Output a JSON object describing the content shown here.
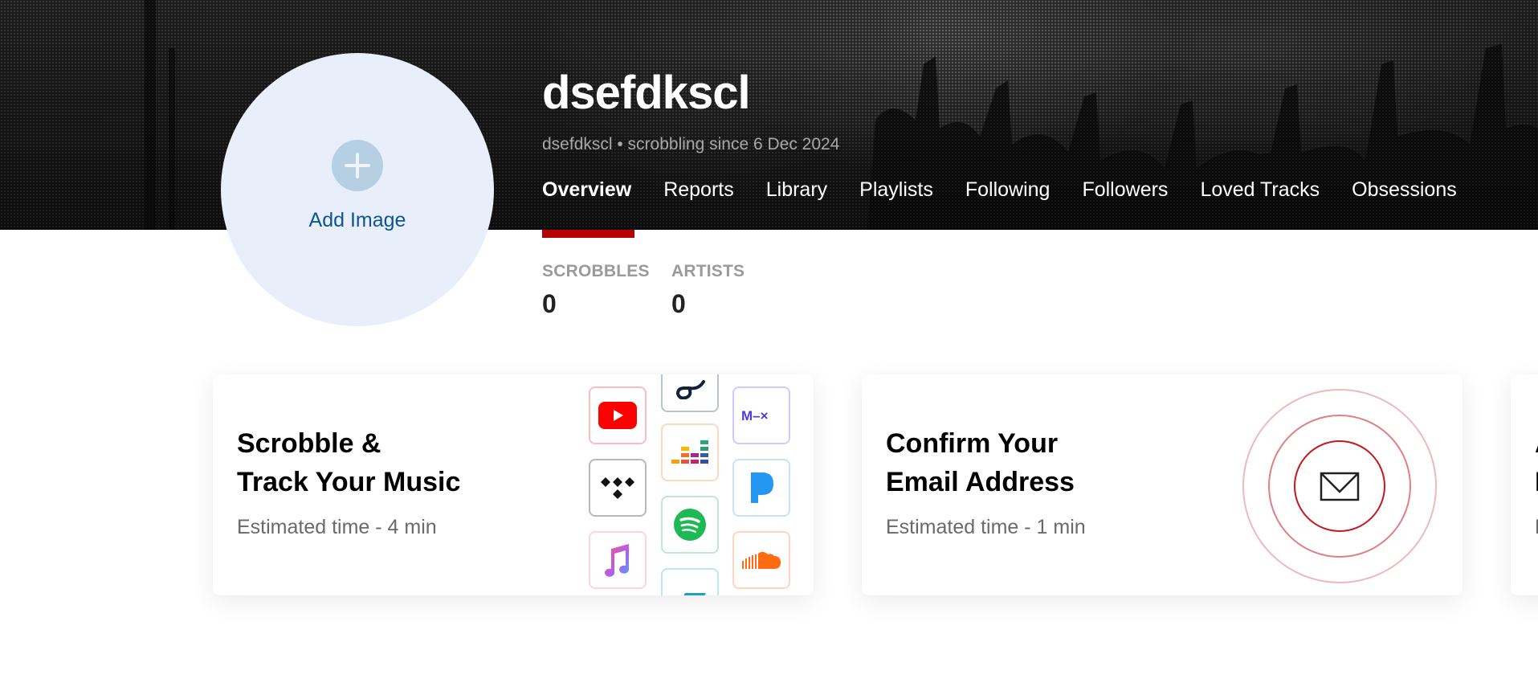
{
  "profile": {
    "username": "dsefdkscl",
    "subline": "dsefdkscl • scrobbling since 6 Dec 2024",
    "avatar": {
      "label": "Add Image",
      "icon": "plus-icon"
    }
  },
  "nav": {
    "items": [
      {
        "label": "Overview",
        "active": true
      },
      {
        "label": "Reports",
        "active": false
      },
      {
        "label": "Library",
        "active": false
      },
      {
        "label": "Playlists",
        "active": false
      },
      {
        "label": "Following",
        "active": false
      },
      {
        "label": "Followers",
        "active": false
      },
      {
        "label": "Loved Tracks",
        "active": false
      },
      {
        "label": "Obsessions",
        "active": false
      }
    ],
    "active_color": "#b90000"
  },
  "stats": [
    {
      "label": "SCROBBLES",
      "value": "0"
    },
    {
      "label": "ARTISTS",
      "value": "0"
    }
  ],
  "cards": [
    {
      "title_line1": "Scrobble &",
      "title_line2": "Track Your Music",
      "subtitle": "Estimated time - 4 min",
      "service_icons": [
        "youtube-icon",
        "tidal-icon",
        "apple-music-icon",
        "qobuz-icon",
        "deezer-icon",
        "spotify-icon",
        "bandcamp-icon",
        "mixcloud-icon",
        "pandora-icon",
        "soundcloud-icon"
      ]
    },
    {
      "title_line1": "Confirm Your",
      "title_line2": "Email Address",
      "subtitle": "Estimated time - 1 min",
      "icon": "envelope-icon",
      "ring_color": "#c8161d"
    },
    {
      "title_line1": "A",
      "title_line2": "I",
      "subtitle": "E"
    }
  ],
  "colors": {
    "avatar_bg": "#e8effa",
    "avatar_text": "#0c5496",
    "accent_red": "#b90000"
  }
}
